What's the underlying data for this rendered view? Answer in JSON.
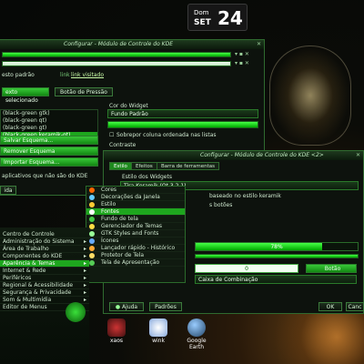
{
  "clock": {
    "weekday": "Dom",
    "month": "SET",
    "day": "24"
  },
  "win1": {
    "title": "Configurar - Módulo de Controle do KDE",
    "close": "✕",
    "reset": "esto padrão",
    "link_pre": "link",
    "link": "link visitado",
    "sel_text": "exto selecionado",
    "pressed": "Botão de Pressão",
    "schemes": [
      "(black-green gtk)",
      "(black-green qt)",
      "(black-green gt)",
      "(black-green keramik-gt)"
    ],
    "save": "Salvar Esquema...",
    "remove": "Remover Esquema",
    "import": "Importar Esquema...",
    "apply_note": "aplicativos que não são do KDE",
    "widget_color": "Cor do Widget",
    "widget_value": "Fundo Padrão",
    "cb1": "Sobrepor coluna ordenada nas listas",
    "contrast": "Contraste",
    "ok": "ida"
  },
  "win2": {
    "title": "Configurar - Módulo de Controle do KDE <2>",
    "tabs": [
      "Estilo",
      "Efeitos",
      "Barra de ferramentas"
    ],
    "style_label": "Estilo dos Widgets",
    "style_value": "Tira Keramik (Qt 3.2.1)",
    "note1": "baseado no estilo keramik",
    "note2": "s botões",
    "progress": "78%",
    "progress_value": 0.78,
    "spin": "0",
    "btn": "Botão",
    "combo": "Caixa de Combinação",
    "help": "Ajuda",
    "defaults": "Padrões",
    "ok": "OK",
    "cancel": "Canc"
  },
  "submenu": [
    "Cores",
    "Decorações da Janela",
    "Estilo",
    "Fontes",
    "Fundo de tela",
    "Gerenciador de Temas",
    "GTK Styles and Fonts",
    "Ícones",
    "Lançador rápido - Histórico",
    "Protetor de Tela",
    "Tela de Apresentação"
  ],
  "submenu_selected": 3,
  "kmenu": [
    {
      "label": "Centro de Controle",
      "sub": false
    },
    {
      "label": "Administração do Sistema",
      "sub": true
    },
    {
      "label": "Área de Trabalho",
      "sub": true
    },
    {
      "label": "Componentes do KDE",
      "sub": true
    },
    {
      "label": "Aparência & Temas",
      "sub": true,
      "selected": true
    },
    {
      "label": "Internet & Rede",
      "sub": true
    },
    {
      "label": "Periféricos",
      "sub": true
    },
    {
      "label": "Regional & Acessibilidade",
      "sub": true
    },
    {
      "label": "Segurança & Privacidade",
      "sub": true
    },
    {
      "label": "Som & Multimídia",
      "sub": true
    },
    {
      "label": "Editor de Menus",
      "sub": false
    }
  ],
  "dock": [
    "xaos",
    "wink",
    "Google Earth"
  ],
  "dock_google": [
    "Google",
    "Earth"
  ],
  "colors": {
    "accent": "#1ea61e",
    "bright": "#46ff46"
  }
}
